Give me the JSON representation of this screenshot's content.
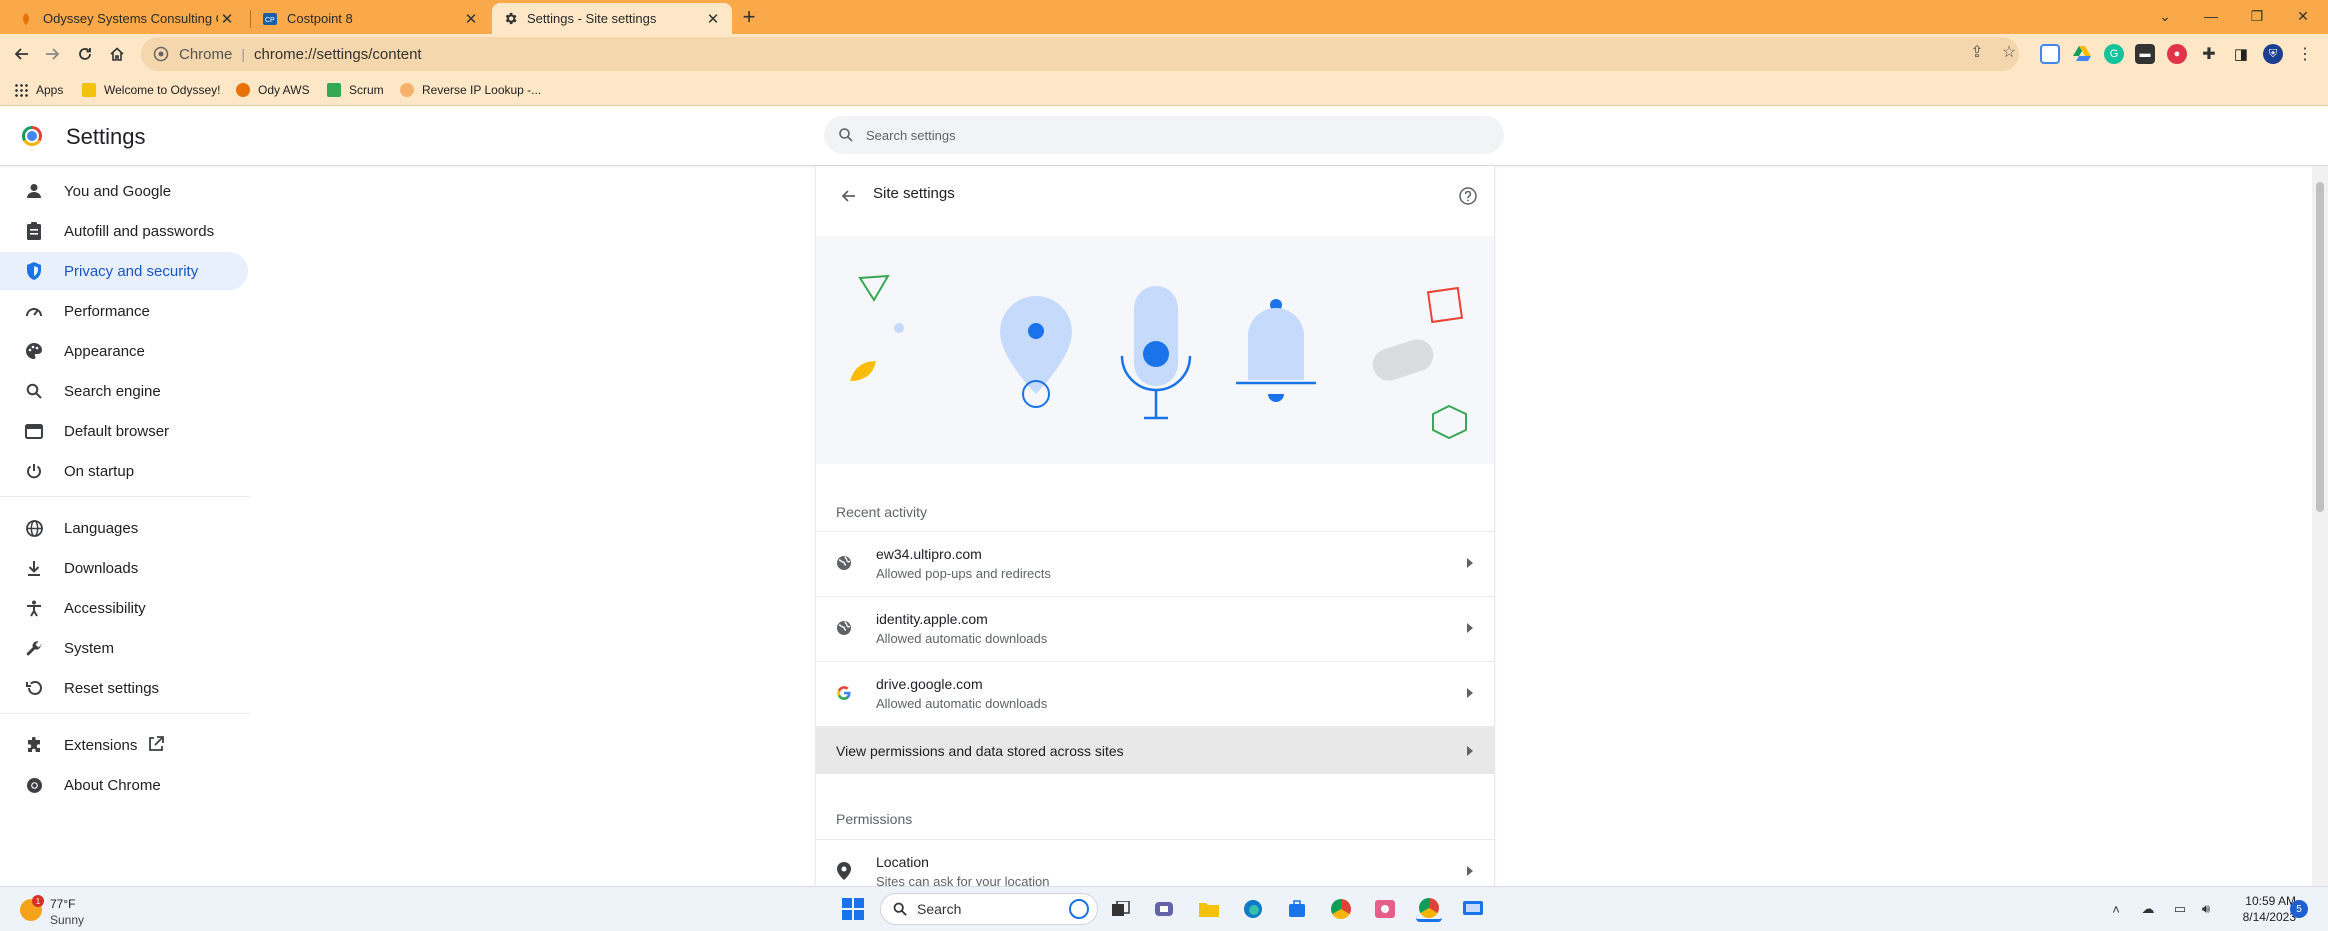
{
  "tabs": [
    {
      "title": "Odyssey Systems Consulting Gro",
      "active": false
    },
    {
      "title": "Costpoint 8",
      "active": false
    },
    {
      "title": "Settings - Site settings",
      "active": true
    }
  ],
  "omnibox": {
    "scheme": "Chrome",
    "url": "chrome://settings/content"
  },
  "bookmarks": [
    "Apps",
    "Welcome to Odyssey!",
    "Ody AWS",
    "Scrum",
    "Reverse IP Lookup -..."
  ],
  "settings": {
    "title": "Settings",
    "search_placeholder": "Search settings"
  },
  "sidebar": {
    "items": [
      {
        "label": "You and Google",
        "icon": "person-icon"
      },
      {
        "label": "Autofill and passwords",
        "icon": "clipboard-icon"
      },
      {
        "label": "Privacy and security",
        "icon": "shield-icon",
        "active": true
      },
      {
        "label": "Performance",
        "icon": "speedometer-icon"
      },
      {
        "label": "Appearance",
        "icon": "palette-icon"
      },
      {
        "label": "Search engine",
        "icon": "search-icon"
      },
      {
        "label": "Default browser",
        "icon": "browser-icon"
      },
      {
        "label": "On startup",
        "icon": "power-icon"
      },
      {
        "label": "Languages",
        "icon": "globe-icon"
      },
      {
        "label": "Downloads",
        "icon": "download-icon"
      },
      {
        "label": "Accessibility",
        "icon": "accessibility-icon"
      },
      {
        "label": "System",
        "icon": "wrench-icon"
      },
      {
        "label": "Reset settings",
        "icon": "reset-icon"
      },
      {
        "label": "Extensions",
        "icon": "puzzle-icon"
      },
      {
        "label": "About Chrome",
        "icon": "chrome-icon"
      }
    ]
  },
  "main": {
    "title": "Site settings",
    "recent_activity_title": "Recent activity",
    "recent": [
      {
        "site": "ew34.ultipro.com",
        "detail": "Allowed pop-ups and redirects",
        "icon": "globe-icon"
      },
      {
        "site": "identity.apple.com",
        "detail": "Allowed automatic downloads",
        "icon": "globe-icon"
      },
      {
        "site": "drive.google.com",
        "detail": "Allowed automatic downloads",
        "icon": "google-icon"
      }
    ],
    "view_permissions_label": "View permissions and data stored across sites",
    "permissions_title": "Permissions",
    "permissions": [
      {
        "label": "Location",
        "detail": "Sites can ask for your location",
        "icon": "location-pin-icon"
      }
    ]
  },
  "taskbar": {
    "weather_temp": "77°F",
    "weather_condition": "Sunny",
    "weather_badge": "1",
    "search_label": "Search",
    "time": "10:59 AM",
    "date": "8/14/2023",
    "notification_count": "5"
  },
  "colors": {
    "title_bar": "#f9a94a",
    "toolbar": "#fde7c6",
    "accent": "#1a73e8",
    "active_nav_bg": "#e8f0fe"
  }
}
